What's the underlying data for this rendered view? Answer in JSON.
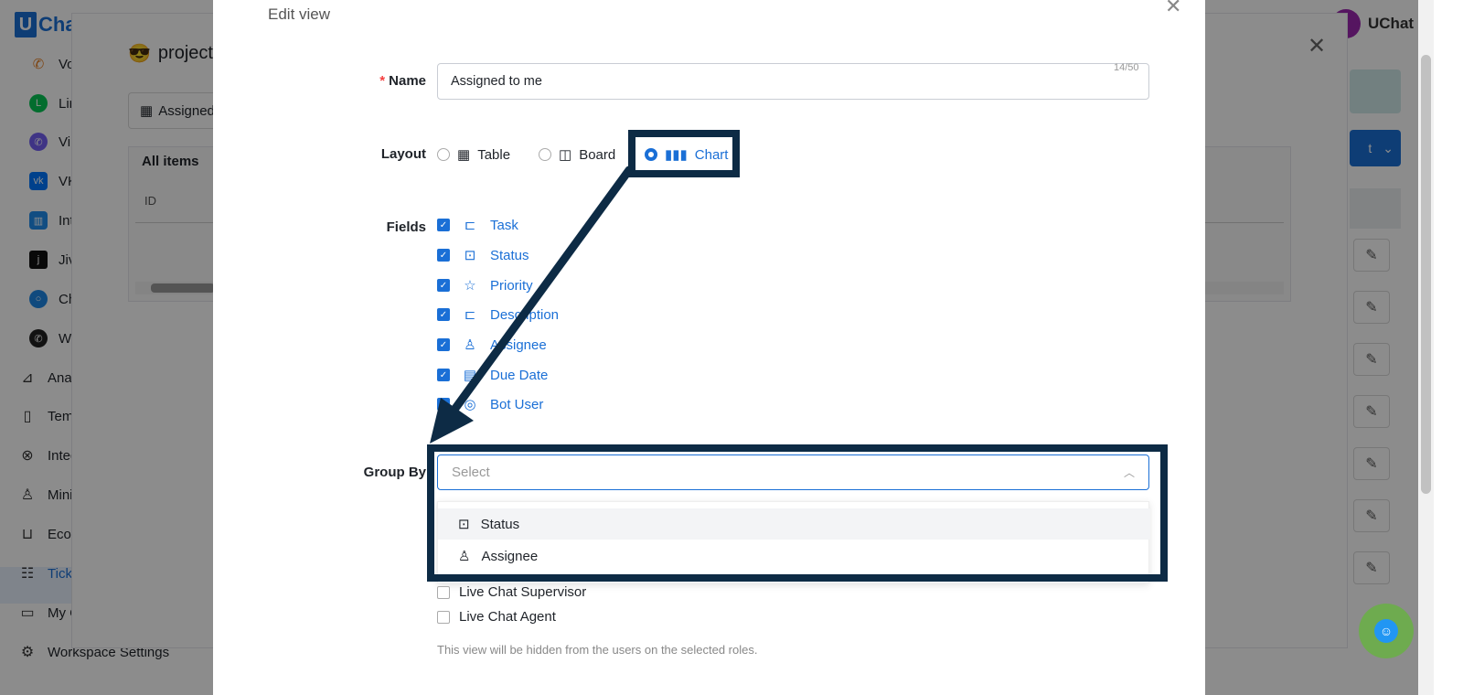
{
  "app": {
    "logo_letter": "U",
    "logo_text": "Cha",
    "account_name": "UChat"
  },
  "sidebar": {
    "items": [
      {
        "label": "Vo",
        "icon": "phone-icon"
      },
      {
        "label": "Lin",
        "icon": "line-icon"
      },
      {
        "label": "Vi",
        "icon": "viber-icon"
      },
      {
        "label": "VK",
        "icon": "vk-icon"
      },
      {
        "label": "Int",
        "icon": "intercom-icon"
      },
      {
        "label": "Jiv",
        "icon": "jivo-icon"
      },
      {
        "label": "Ch",
        "icon": "chat-icon"
      },
      {
        "label": "W",
        "icon": "whatsapp-icon"
      },
      {
        "label": "Ana",
        "icon": "analytics-icon"
      },
      {
        "label": "Tem",
        "icon": "template-icon"
      },
      {
        "label": "Integ",
        "icon": "integration-icon"
      },
      {
        "label": "Mini",
        "icon": "user-icon"
      },
      {
        "label": "Eco",
        "icon": "cart-icon"
      },
      {
        "label": "Tick",
        "icon": "ticket-icon"
      },
      {
        "label": "My C",
        "icon": "page-icon"
      },
      {
        "label": "Workspace Settings",
        "icon": "gear-icon"
      }
    ]
  },
  "project": {
    "emoji": "😎",
    "title": "project r",
    "view_tab": "Assigned",
    "table_title": "All items",
    "col_id": "ID",
    "btn_text": "t"
  },
  "modal": {
    "title": "Edit view",
    "name": {
      "label": "Name",
      "required_mark": "*",
      "value": "Assigned to me",
      "counter": "14/50"
    },
    "layout": {
      "label": "Layout",
      "options": [
        {
          "label": "Table",
          "selected": false
        },
        {
          "label": "Board",
          "selected": false
        },
        {
          "label": "Chart",
          "selected": true
        }
      ]
    },
    "fields": {
      "label": "Fields",
      "items": [
        {
          "label": "Task",
          "icon": "text-field-icon",
          "checked": true
        },
        {
          "label": "Status",
          "icon": "select-field-icon",
          "checked": true
        },
        {
          "label": "Priority",
          "icon": "star-icon",
          "checked": true
        },
        {
          "label": "Description",
          "icon": "text-field-icon",
          "checked": true
        },
        {
          "label": "Assignee",
          "icon": "user-icon",
          "checked": true
        },
        {
          "label": "Due Date",
          "icon": "calendar-icon",
          "checked": true
        },
        {
          "label": "Bot User",
          "icon": "bot-user-icon",
          "checked": true
        }
      ]
    },
    "group_by": {
      "label": "Group By",
      "placeholder": "Select",
      "options": [
        {
          "label": "Status",
          "icon": "select-field-icon"
        },
        {
          "label": "Assignee",
          "icon": "user-icon"
        }
      ]
    },
    "roles": {
      "items": [
        {
          "label": "Live Chat Supervisor",
          "checked": false
        },
        {
          "label": "Live Chat Agent",
          "checked": false
        }
      ],
      "hint": "This view will be hidden from the users on the selected roles."
    }
  },
  "colors": {
    "accent": "#1a6fd6",
    "annotation": "#0d2b45"
  }
}
